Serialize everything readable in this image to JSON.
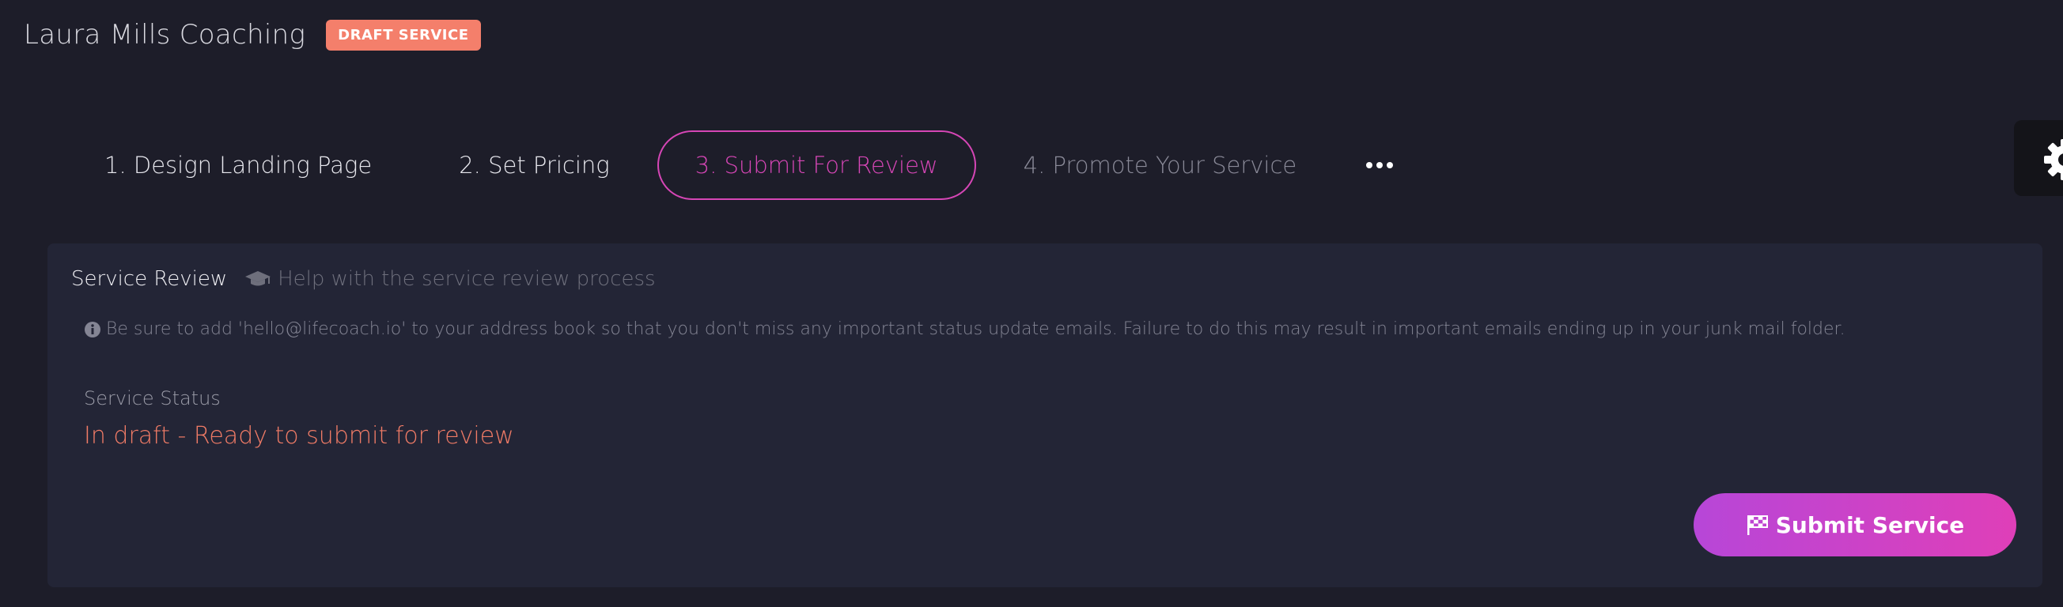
{
  "header": {
    "title": "Laura Mills Coaching",
    "badge": "DRAFT SERVICE"
  },
  "steps": [
    {
      "label": "1. Design Landing Page",
      "state": "completed"
    },
    {
      "label": "2. Set Pricing",
      "state": "completed"
    },
    {
      "label": "3. Submit For Review",
      "state": "active"
    },
    {
      "label": "4. Promote Your Service",
      "state": "inactive"
    }
  ],
  "more_menu": {
    "icon": "ellipsis-icon"
  },
  "settings_tab": {
    "icon": "gear-icon"
  },
  "review_card": {
    "title": "Service Review",
    "help_link": "Help with the service review process",
    "help_icon": "graduation-cap-icon",
    "notice_icon": "info-circle-icon",
    "notice": "Be sure to add 'hello@lifecoach.io' to your address book so that you don't miss any important status update emails. Failure to do this may result in important emails ending up in your junk mail folder.",
    "status_label": "Service Status",
    "status_value": "In draft - Ready to submit for review",
    "submit_button": "Submit Service",
    "submit_icon": "checkered-flag-icon"
  },
  "colors": {
    "background": "#1d1d29",
    "card": "#232536",
    "accent": "#d646b6",
    "badge": "#f47f6b",
    "status": "#f07b66"
  }
}
